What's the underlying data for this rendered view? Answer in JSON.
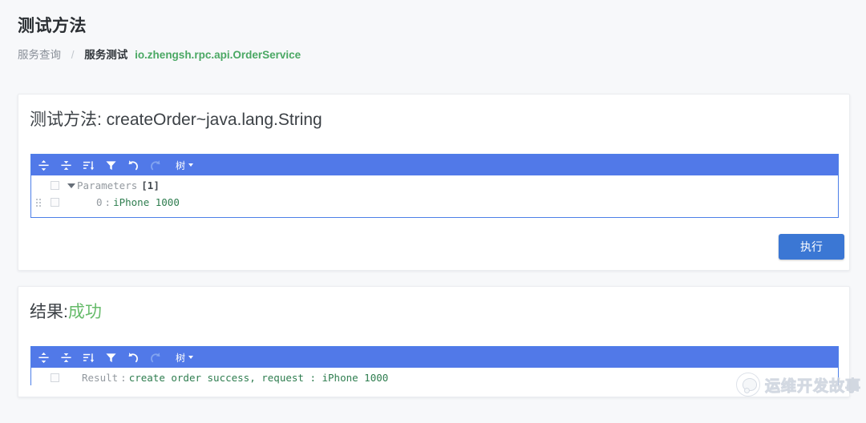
{
  "header": {
    "title": "测试方法",
    "breadcrumb": {
      "item1": "服务查询",
      "separator": "/",
      "item2": "服务测试",
      "service": "io.zhengsh.rpc.api.OrderService"
    }
  },
  "test_card": {
    "title_prefix": "测试方法: ",
    "method": "createOrder~java.lang.String",
    "editor": {
      "mode_label": "树",
      "toolbar": [
        {
          "name": "expand-all-icon",
          "title": "展开全部"
        },
        {
          "name": "collapse-all-icon",
          "title": "收起全部"
        },
        {
          "name": "sort-icon",
          "title": "排序"
        },
        {
          "name": "filter-icon",
          "title": "筛选"
        },
        {
          "name": "undo-icon",
          "title": "撤销"
        },
        {
          "name": "redo-icon",
          "title": "重做"
        }
      ],
      "rows": [
        {
          "field": "Parameters",
          "count": "[1]",
          "expanded": true
        },
        {
          "index": "0",
          "separator": ":",
          "value": "iPhone 1000"
        }
      ]
    },
    "execute_label": "执行"
  },
  "result_card": {
    "title_prefix": "结果:",
    "status": "成功",
    "editor": {
      "mode_label": "树",
      "rows": [
        {
          "field": "Result",
          "separator": ":",
          "value": "create order success, request : iPhone 1000"
        }
      ]
    }
  },
  "watermark": {
    "text": "运维开发故事"
  },
  "colors": {
    "accent_blue": "#5179e8",
    "button_blue": "#3b77d4",
    "success_green": "#66bb6a",
    "value_green": "#2e7d4f",
    "link_green": "#4aa863",
    "page_bg": "#f7f8fa"
  }
}
